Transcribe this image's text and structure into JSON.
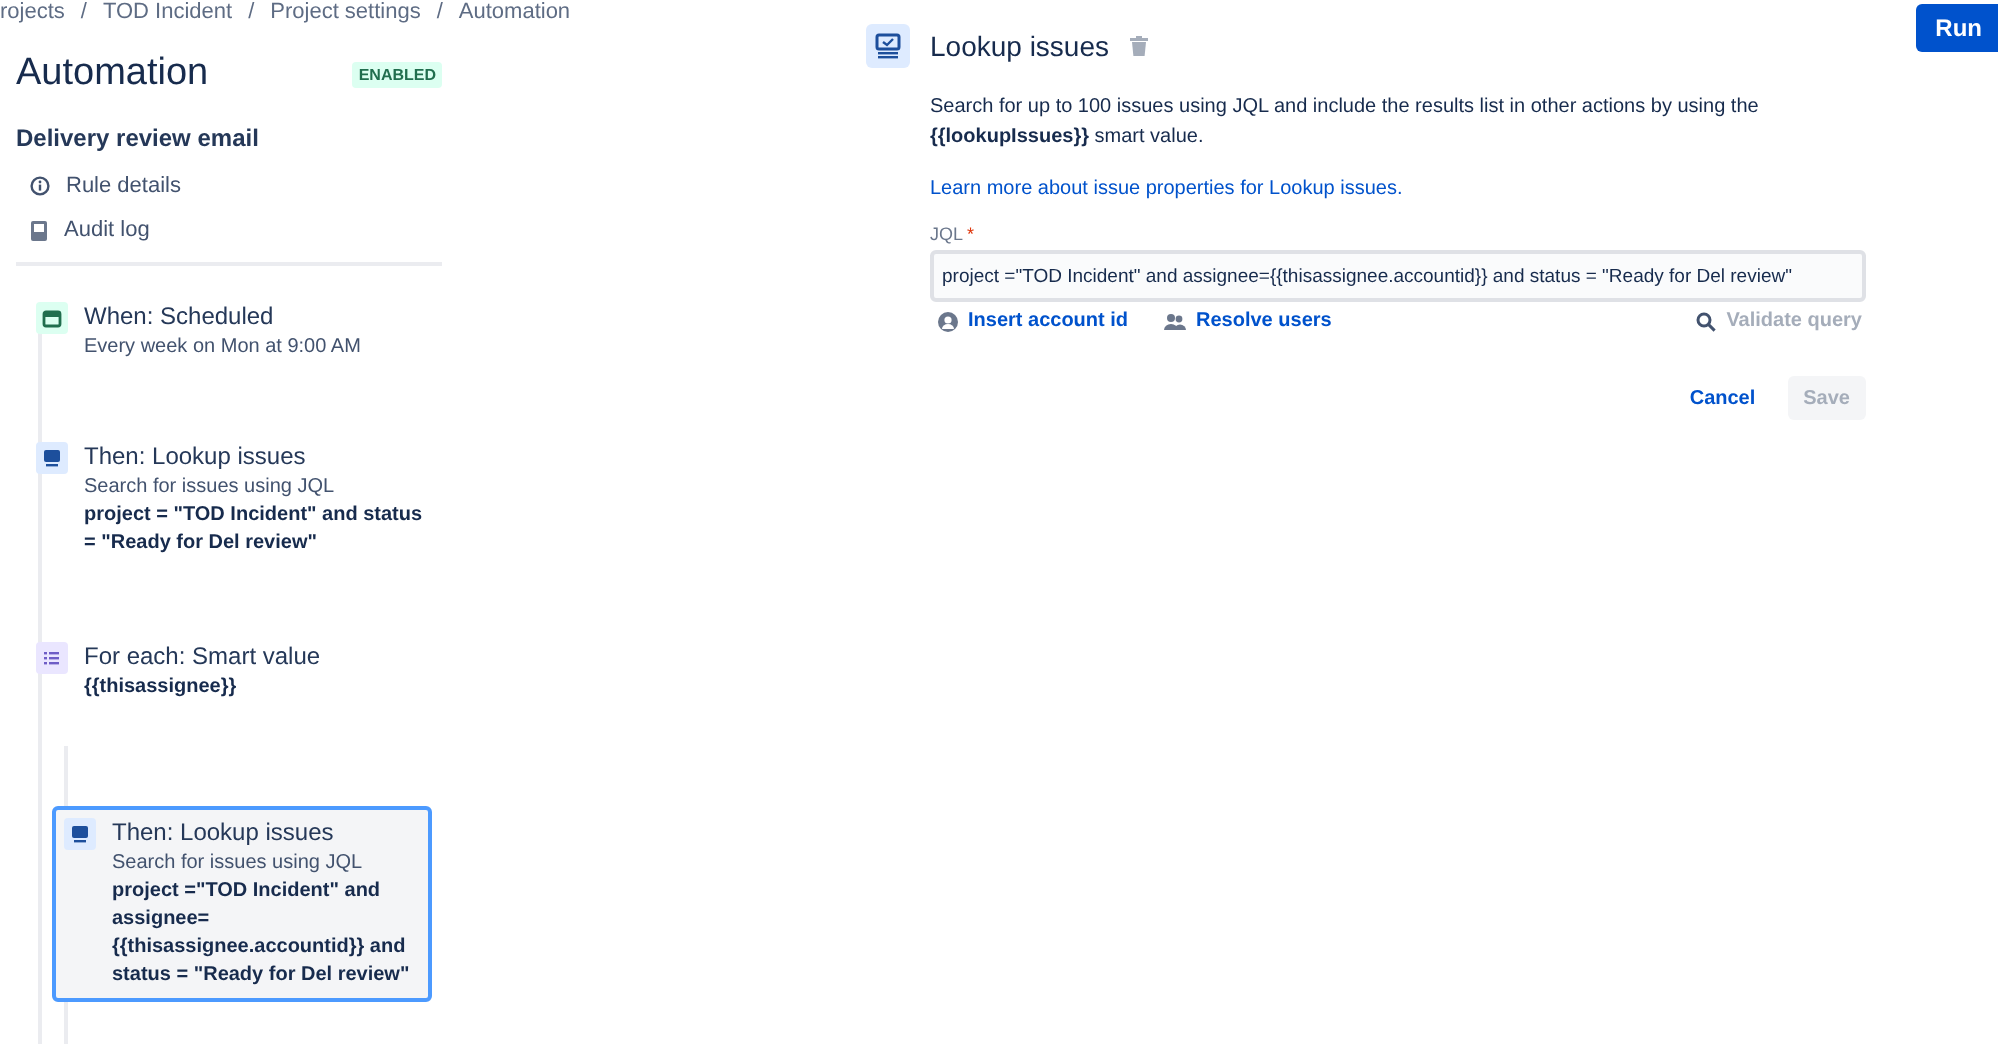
{
  "breadcrumbs": [
    "rojects",
    "TOD Incident",
    "Project settings",
    "Automation"
  ],
  "breadcrumb_separator": "/",
  "header": {
    "title": "Automation",
    "status": "ENABLED",
    "run_button": "Run"
  },
  "rule": {
    "name": "Delivery review email",
    "links": [
      {
        "kind": "info",
        "label": "Rule details"
      },
      {
        "kind": "log",
        "label": "Audit log"
      }
    ]
  },
  "steps": [
    {
      "kind": "trigger",
      "title": "When: Scheduled",
      "subtitle": "Every week on Mon at 9:00 AM",
      "selected": false
    },
    {
      "kind": "action",
      "title": "Then: Lookup issues",
      "subtitle": "Search for issues using JQL",
      "query": "project = \"TOD Incident\" and status = \"Ready for Del review\"",
      "selected": false
    },
    {
      "kind": "branch",
      "title": "For each: Smart value",
      "query": "{{thisassignee}}",
      "selected": false,
      "children": [
        {
          "kind": "action",
          "title": "Then: Lookup issues",
          "subtitle": "Search for issues using JQL",
          "query": "project =\"TOD Incident\" and assignee= {{thisassignee.accountid}} and status = \"Ready for Del review\"",
          "selected": true
        }
      ]
    }
  ],
  "detail": {
    "title": "Lookup issues",
    "description": "Search for up to 100 issues using JQL and include the results list in other actions by using the **{{lookupIssues}}** smart value.",
    "learn_more": "Learn more about issue properties for Lookup issues.",
    "jql_label": "JQL",
    "required_mark": "*",
    "jql_value": "project =\"TOD Incident\" and assignee={{thisassignee.accountid}} and status = \"Ready for Del review\"",
    "tools": [
      {
        "kind": "account",
        "label": "Insert account id",
        "disabled": false
      },
      {
        "kind": "users",
        "label": "Resolve users",
        "disabled": false
      },
      {
        "kind": "validate",
        "label": "Validate query",
        "disabled": true
      }
    ],
    "cancel": "Cancel",
    "save": {
      "label": "Save",
      "disabled": true
    }
  }
}
